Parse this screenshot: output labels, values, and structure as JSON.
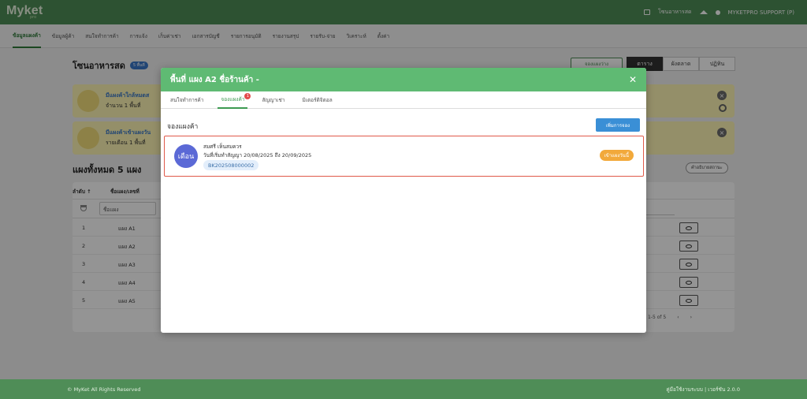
{
  "app": {
    "logo_main": "Myket",
    "logo_sub": "pro",
    "shop_name": "โซนอาหารสด",
    "user_label": "MYKETPRO SUPPORT (P)"
  },
  "nav": {
    "items": [
      "ข้อมูลแผงค้า",
      "ข้อมูลผู้ค้า",
      "สนใจทำการค้า",
      "การแจ้ง",
      "เก็บค่าเช่า",
      "เอกสารบัญชี",
      "รายการอนุมัติ",
      "รายงานสรุป",
      "รายรับ-จ่าย",
      "วิเคราะห์",
      "ตั้งค่า"
    ]
  },
  "page": {
    "title": "โซนอาหารสด",
    "title_badge": "5 พื้นที่",
    "btn_book": "จองแผงว่าง",
    "view_tabs": [
      "ตาราง",
      "ผังตลาด",
      "ปฏิทิน"
    ],
    "alert1_title": "มีแผงค้าใกล้หมดส",
    "alert1_text": "จำนวน 1 พื้นที่",
    "alert2_title": "มีแผงค้าเข้าแผงวัน",
    "alert2_text": "รายเดือน 1 พื้นที่",
    "section_title": "แผงทั้งหมด 5 แผง",
    "help_btn": "คำอธิบายสถานะ",
    "table": {
      "col_order": "ลำดับ ↑",
      "col_name": "ชื่อแผง/เลขที่",
      "filter_placeholder": "ชื่อแผง",
      "rows": [
        {
          "n": "1",
          "name": "แผง A1"
        },
        {
          "n": "2",
          "name": "แผง A2"
        },
        {
          "n": "3",
          "name": "แผง A3"
        },
        {
          "n": "4",
          "name": "แผง A4"
        },
        {
          "n": "5",
          "name": "แผง A5"
        }
      ],
      "pager": "1-5 of 5"
    }
  },
  "modal": {
    "title": "พื้นที่ แผง A2  ชื่อร้านค้า -",
    "tabs": [
      "สนใจทำการค้า",
      "จองแผงค้า",
      "สัญญาเช่า",
      "มิเตอร์ดิจิตอล"
    ],
    "tab_badge": "1",
    "section_title": "จองแผงค้า",
    "add_button": "เพิ่มการจอง",
    "booking": {
      "avatar": "เดือน",
      "name": "สมศรี เห็นสมควร",
      "dates": "วันที่เริ่มทำสัญญา 20/08/2025 ถึง 20/09/2025",
      "code": "BK202508000002",
      "status": "เข้าแผงวันนี้"
    }
  },
  "footer": {
    "copyright": "© MyKet All Rights Reserved",
    "version": "คู่มือใช้งานระบบ | เวอร์ชัน 2.0.0"
  }
}
